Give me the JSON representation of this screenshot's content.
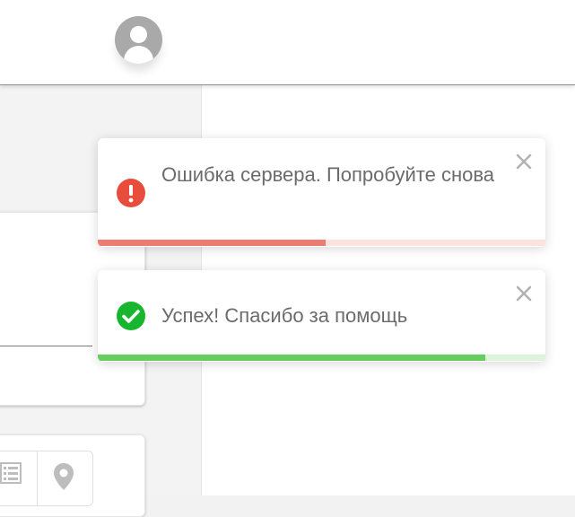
{
  "header": {
    "avatar_icon": "user-avatar-icon"
  },
  "toasts": [
    {
      "type": "error",
      "message": "Ошибка сервера. Попробуйте снова",
      "icon": "exclamation-icon",
      "close_icon": "close-icon",
      "progress": 0.51,
      "colors": {
        "icon": "#e74c3c",
        "fill": "#ef7c70",
        "track": "#fde2de"
      }
    },
    {
      "type": "success",
      "message": "Успех! Спасибо за помощь",
      "icon": "check-icon",
      "close_icon": "close-icon",
      "progress": 0.865,
      "colors": {
        "icon": "#18b52f",
        "fill": "#66cd5f",
        "track": "#dcf4da"
      }
    }
  ],
  "background": {
    "icons": [
      "list-icon",
      "map-pin-icon"
    ]
  }
}
